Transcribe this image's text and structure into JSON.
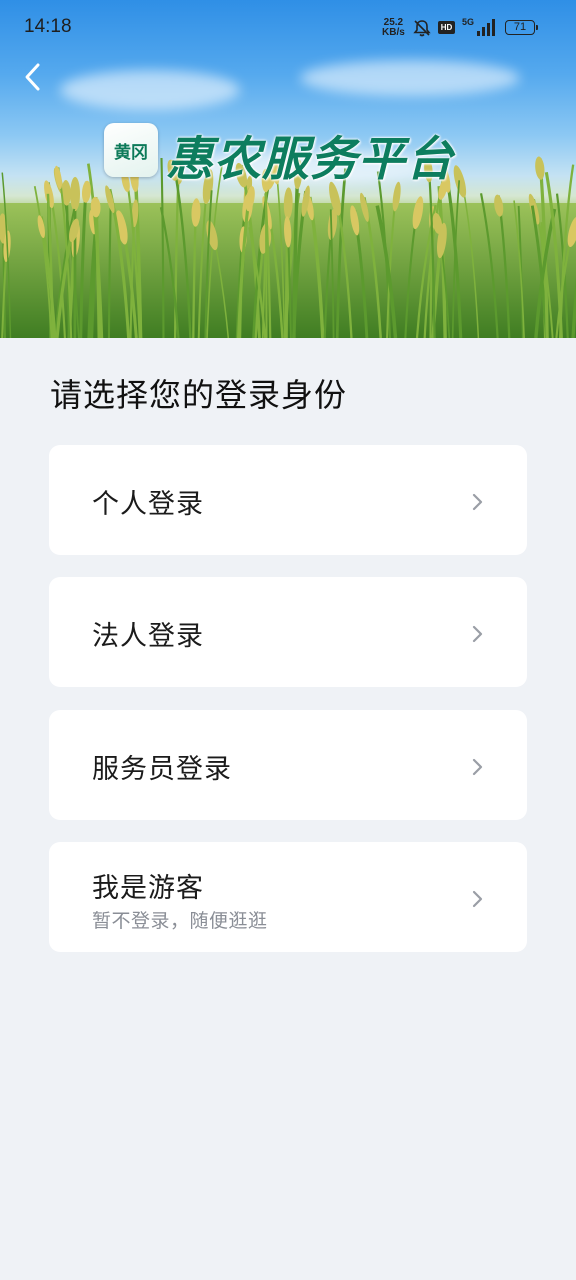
{
  "status_bar": {
    "time": "14:18",
    "net_speed_value": "25.2",
    "net_speed_unit": "KB/s",
    "hd_badge": "HD",
    "network_type": "5G",
    "battery_level": "71",
    "icons": [
      "bell-muted-icon",
      "hd-icon",
      "signal-icon",
      "battery-icon"
    ]
  },
  "header": {
    "back_icon": "chevron-left-icon",
    "logo_badge_text": "黄冈",
    "app_title": "惠农服务平台"
  },
  "main": {
    "prompt": "请选择您的登录身份",
    "options": [
      {
        "title": "个人登录",
        "subtitle": ""
      },
      {
        "title": "法人登录",
        "subtitle": ""
      },
      {
        "title": "服务员登录",
        "subtitle": ""
      },
      {
        "title": "我是游客",
        "subtitle": "暂不登录，随便逛逛"
      }
    ],
    "option_icon": "chevron-right-icon"
  },
  "colors": {
    "page_background": "#eff2f6",
    "card_background": "#ffffff",
    "logo_green": "#0d7d5e",
    "chevron": "#9a9ea6"
  }
}
